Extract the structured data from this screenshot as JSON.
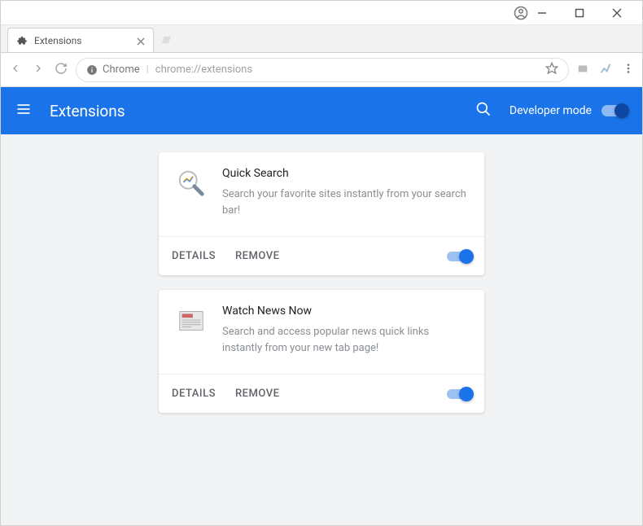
{
  "window": {
    "tab_title": "Extensions"
  },
  "omnibox": {
    "secure_label": "Chrome",
    "url": "chrome://extensions"
  },
  "header": {
    "title": "Extensions",
    "dev_mode_label": "Developer mode",
    "dev_mode_on": true
  },
  "buttons": {
    "details": "DETAILS",
    "remove": "REMOVE"
  },
  "extensions": [
    {
      "name": "Quick Search",
      "description": "Search your favorite sites instantly from your search bar!",
      "enabled": true,
      "icon": "magnifier"
    },
    {
      "name": "Watch News Now",
      "description": "Search and access popular news quick links instantly from your new tab page!",
      "enabled": true,
      "icon": "news"
    }
  ]
}
